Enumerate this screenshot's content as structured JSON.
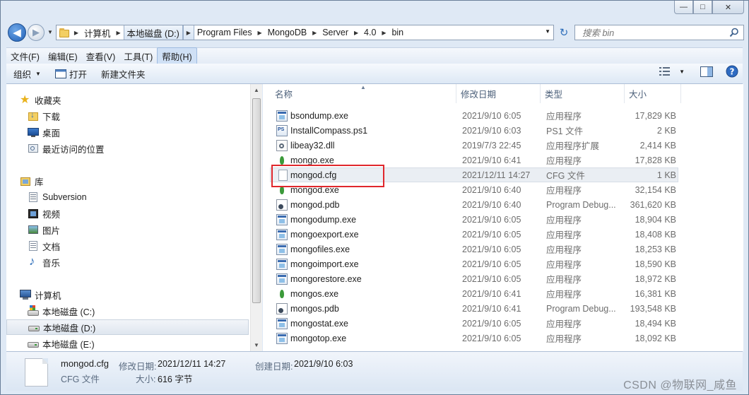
{
  "window": {
    "buttons": {
      "minimize": "—",
      "maximize": "□",
      "close": "✕"
    }
  },
  "address": {
    "crumbs": [
      "计算机",
      "本地磁盘 (D:)",
      "Program Files",
      "MongoDB",
      "Server",
      "4.0",
      "bin"
    ],
    "search_placeholder": "搜索 bin"
  },
  "menu": [
    "文件(F)",
    "编辑(E)",
    "查看(V)",
    "工具(T)",
    "帮助(H)"
  ],
  "toolbar": {
    "organize": "组织",
    "open": "打开",
    "new_folder": "新建文件夹"
  },
  "nav": {
    "favorites": "收藏夹",
    "downloads": "下载",
    "desktop": "桌面",
    "recent": "最近访问的位置",
    "libraries": "库",
    "subversion": "Subversion",
    "videos": "视频",
    "pictures": "图片",
    "documents": "文档",
    "music": "音乐",
    "computer": "计算机",
    "drive_c": "本地磁盘 (C:)",
    "drive_d": "本地磁盘 (D:)",
    "drive_e": "本地磁盘 (E:)"
  },
  "columns": {
    "name": "名称",
    "date": "修改日期",
    "type": "类型",
    "size": "大小"
  },
  "files": [
    {
      "name": "bsondump.exe",
      "date": "2021/9/10 6:05",
      "type": "应用程序",
      "size": "17,829 KB",
      "icon": "exe"
    },
    {
      "name": "InstallCompass.ps1",
      "date": "2021/9/10 6:03",
      "type": "PS1 文件",
      "size": "2 KB",
      "icon": "ps"
    },
    {
      "name": "libeay32.dll",
      "date": "2019/7/3 22:45",
      "type": "应用程序扩展",
      "size": "2,414 KB",
      "icon": "dll"
    },
    {
      "name": "mongo.exe",
      "date": "2021/9/10 6:41",
      "type": "应用程序",
      "size": "17,828 KB",
      "icon": "leaf"
    },
    {
      "name": "mongod.cfg",
      "date": "2021/12/11 14:27",
      "type": "CFG 文件",
      "size": "1 KB",
      "icon": "doc"
    },
    {
      "name": "mongod.exe",
      "date": "2021/9/10 6:40",
      "type": "应用程序",
      "size": "32,154 KB",
      "icon": "leaf"
    },
    {
      "name": "mongod.pdb",
      "date": "2021/9/10 6:40",
      "type": "Program Debug...",
      "size": "361,620 KB",
      "icon": "pdb"
    },
    {
      "name": "mongodump.exe",
      "date": "2021/9/10 6:05",
      "type": "应用程序",
      "size": "18,904 KB",
      "icon": "exe"
    },
    {
      "name": "mongoexport.exe",
      "date": "2021/9/10 6:05",
      "type": "应用程序",
      "size": "18,408 KB",
      "icon": "exe"
    },
    {
      "name": "mongofiles.exe",
      "date": "2021/9/10 6:05",
      "type": "应用程序",
      "size": "18,253 KB",
      "icon": "exe"
    },
    {
      "name": "mongoimport.exe",
      "date": "2021/9/10 6:05",
      "type": "应用程序",
      "size": "18,590 KB",
      "icon": "exe"
    },
    {
      "name": "mongorestore.exe",
      "date": "2021/9/10 6:05",
      "type": "应用程序",
      "size": "18,972 KB",
      "icon": "exe"
    },
    {
      "name": "mongos.exe",
      "date": "2021/9/10 6:41",
      "type": "应用程序",
      "size": "16,381 KB",
      "icon": "leaf"
    },
    {
      "name": "mongos.pdb",
      "date": "2021/9/10 6:41",
      "type": "Program Debug...",
      "size": "193,548 KB",
      "icon": "pdb"
    },
    {
      "name": "mongostat.exe",
      "date": "2021/9/10 6:05",
      "type": "应用程序",
      "size": "18,494 KB",
      "icon": "exe"
    },
    {
      "name": "mongotop.exe",
      "date": "2021/9/10 6:05",
      "type": "应用程序",
      "size": "18,092 KB",
      "icon": "exe"
    }
  ],
  "details": {
    "name": "mongod.cfg",
    "type": "CFG 文件",
    "modified_label": "修改日期:",
    "modified": "2021/12/11 14:27",
    "size_label": "大小:",
    "size": "616 字节",
    "created_label": "创建日期:",
    "created": "2021/9/10 6:03"
  },
  "watermark": "CSDN @物联网_咸鱼"
}
